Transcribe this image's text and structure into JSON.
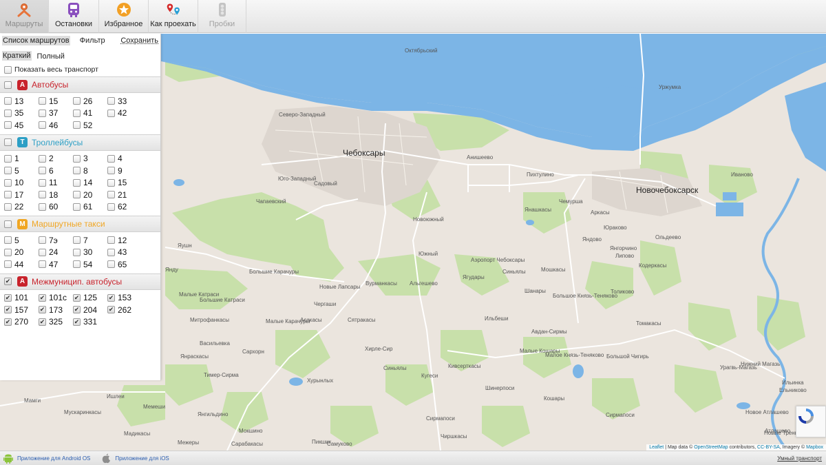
{
  "toolbar": {
    "routes": "Маршруты",
    "stops": "Остановки",
    "favorites": "Избранное",
    "how_to_get": "Как проехать",
    "traffic": "Пробки"
  },
  "panel": {
    "tab_list": "Список маршрутов",
    "tab_filter": "Фильтр",
    "save": "Сохранить",
    "mode_short": "Краткий",
    "mode_full": "Полный",
    "show_all": "Показать весь транспорт",
    "groups": [
      {
        "badge": "А",
        "badge_color": "#c8232c",
        "title": "Автобусы",
        "title_color": "#c8232c",
        "checked": false,
        "routes": [
          "13",
          "15",
          "26",
          "33",
          "35",
          "37",
          "41",
          "42",
          "45",
          "46",
          "52"
        ],
        "routes_checked": false
      },
      {
        "badge": "Т",
        "badge_color": "#2d9fc5",
        "title": "Троллейбусы",
        "title_color": "#2d9fc5",
        "checked": false,
        "routes": [
          "1",
          "2",
          "3",
          "4",
          "5",
          "6",
          "8",
          "9",
          "10",
          "11",
          "14",
          "15",
          "17",
          "18",
          "20",
          "21",
          "22",
          "60",
          "61",
          "62"
        ],
        "routes_checked": false
      },
      {
        "badge": "М",
        "badge_color": "#f0a623",
        "title": "Маршрутные такси",
        "title_color": "#f0a623",
        "checked": false,
        "routes": [
          "5",
          "7э",
          "7",
          "12",
          "20",
          "24",
          "30",
          "43",
          "44",
          "47",
          "54",
          "65"
        ],
        "routes_checked": false
      },
      {
        "badge": "А",
        "badge_color": "#c8232c",
        "title": "Межмуницип. автобусы",
        "title_color": "#c8232c",
        "checked": true,
        "routes": [
          "101",
          "101с",
          "125",
          "153",
          "157",
          "173",
          "204",
          "262",
          "270",
          "325",
          "331"
        ],
        "routes_checked": true
      }
    ]
  },
  "map": {
    "big_labels": [
      "Чебоксары",
      "Новочебоксарск"
    ],
    "labels": [
      "Октябрьский",
      "Уржумка",
      "Северо-Западный",
      "Анишеево",
      "Пихтулино",
      "Ивановo",
      "Юго-Западный",
      "Садовый",
      "Чапаевский",
      "Янашкасы",
      "Чемурша",
      "Аркасы",
      "Юраково",
      "Новоюжный",
      "Ольдеево",
      "Яушн",
      "Южный",
      "Аэропорт Чебоксары",
      "Янгорчино",
      "Яндово",
      "Липово",
      "Большие Карачуры",
      "Синьялы",
      "Мошкасы",
      "Кодеркасы",
      "Янду",
      "Новые Лапсары",
      "Вурманкасы",
      "Альгешево",
      "Ягудары",
      "Шанары",
      "Толиково",
      "Малые Катраси",
      "Большие Катраси",
      "Чергаши",
      "Ильбеши",
      "Большое Князь-Теняково",
      "Митрофанкасы",
      "Асакасы",
      "Сятракасы",
      "Малые Карачуры",
      "Томакасы",
      "Васильевка",
      "Сархорн",
      "Хирле-Сир",
      "Авдан-Сирмы",
      "Янраскасы",
      "Малые Кошары",
      "Малое Князь-Теняково",
      "Большой Чигирь",
      "Нижний Магазь",
      "Тимер-Сирма",
      "Хурынлых",
      "Синьялы",
      "Кугеси",
      "Кивсерткасы",
      "Урагвь-Магазь",
      "Ильинка",
      "Мамги",
      "Ишлеи",
      "Шинерпоси",
      "Ельниково",
      "Мускаринкасы",
      "Кошары",
      "Сирмапоси",
      "Мемеши",
      "Янгильдино",
      "Новое Атлашево",
      "Мадикасы",
      "Мокшино",
      "Пикшик",
      "Сирмапоси",
      "Чиршкасы",
      "Новые Тренькасы",
      "Атлашево",
      "Межеры",
      "Сарабакасы",
      "Самуково"
    ],
    "attribution_leaflet": "Leaflet",
    "attribution_text1": " | Map data © ",
    "attribution_osm": "OpenStreetMap",
    "attribution_text2": " contributors, ",
    "attribution_cc": "CC-BY-SA",
    "attribution_text3": ", Imagery © ",
    "attribution_mapbox": "Mapbox"
  },
  "footer": {
    "android": "Приложение для Android OS",
    "ios": "Приложение для iOS",
    "brand": "Умный транспорт"
  },
  "colors": {
    "water": "#7cb5e6",
    "forest": "#c5dfa6",
    "land": "#ebe5de",
    "road": "#ffffff"
  }
}
